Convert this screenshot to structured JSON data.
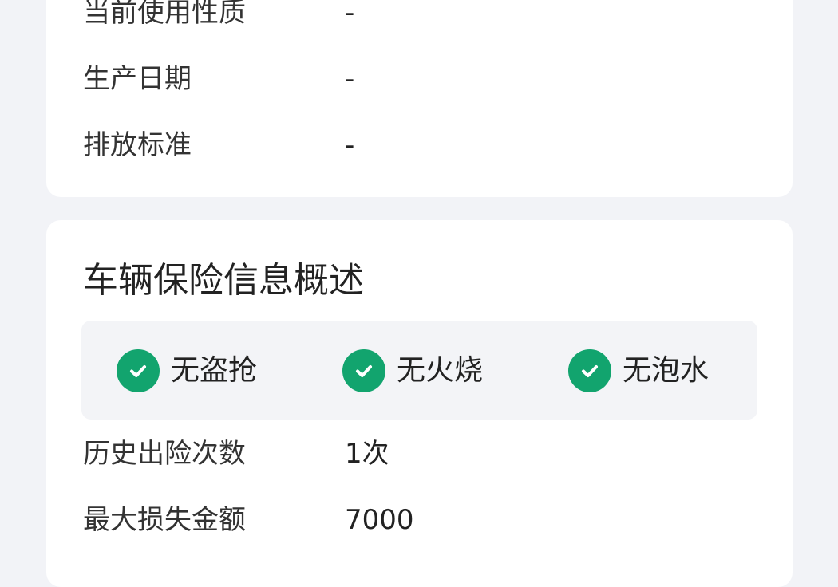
{
  "vehicle_info": {
    "rows": [
      {
        "label": "当前使用性质",
        "value": "-"
      },
      {
        "label": "生产日期",
        "value": "-"
      },
      {
        "label": "排放标准",
        "value": "-"
      }
    ]
  },
  "insurance": {
    "title": "车辆保险信息概述",
    "badges": [
      {
        "label": "无盗抢",
        "icon": "check-circle-icon"
      },
      {
        "label": "无火烧",
        "icon": "check-circle-icon"
      },
      {
        "label": "无泡水",
        "icon": "check-circle-icon"
      }
    ],
    "rows": [
      {
        "label": "历史出险次数",
        "value": "1次"
      },
      {
        "label": "最大损失金额",
        "value": "7000"
      }
    ]
  },
  "colors": {
    "page_background": "#f2f3f7",
    "card_background": "#ffffff",
    "check_green": "#12a46e",
    "badge_panel": "#f3f4f7"
  }
}
